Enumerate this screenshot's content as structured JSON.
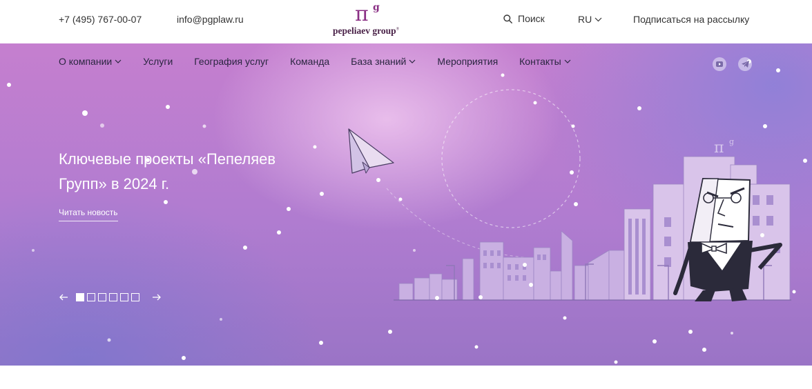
{
  "topbar": {
    "phone": "+7 (495) 767-00-07",
    "email": "info@pgplaw.ru",
    "logo": {
      "symbol": "π",
      "superscript": "g",
      "brand": "pepeliaev group",
      "registered": "®"
    },
    "search_label": "Поиск",
    "language": "RU",
    "subscribe": "Подписаться на рассылку"
  },
  "nav": {
    "items": [
      {
        "label": "О компании",
        "has_dropdown": true
      },
      {
        "label": "Услуги",
        "has_dropdown": false
      },
      {
        "label": "География услуг",
        "has_dropdown": false
      },
      {
        "label": "Команда",
        "has_dropdown": false
      },
      {
        "label": "База знаний",
        "has_dropdown": true
      },
      {
        "label": "Мероприятия",
        "has_dropdown": false
      },
      {
        "label": "Контакты",
        "has_dropdown": true
      }
    ],
    "social": [
      {
        "name": "youtube-icon"
      },
      {
        "name": "telegram-icon"
      }
    ]
  },
  "hero": {
    "headline": "Ключевые проекты «Пепеляев Групп» в 2024 г.",
    "read_more": "Читать новость",
    "slides_total": 6,
    "active_slide": 1,
    "building_logo": "π",
    "building_logo_sup": "g"
  },
  "colors": {
    "brand_purple": "#8a2f84",
    "hero_pink": "#c57fcf",
    "hero_violet": "#9a74c6",
    "text_dark": "#2a2540",
    "white": "#ffffff"
  }
}
